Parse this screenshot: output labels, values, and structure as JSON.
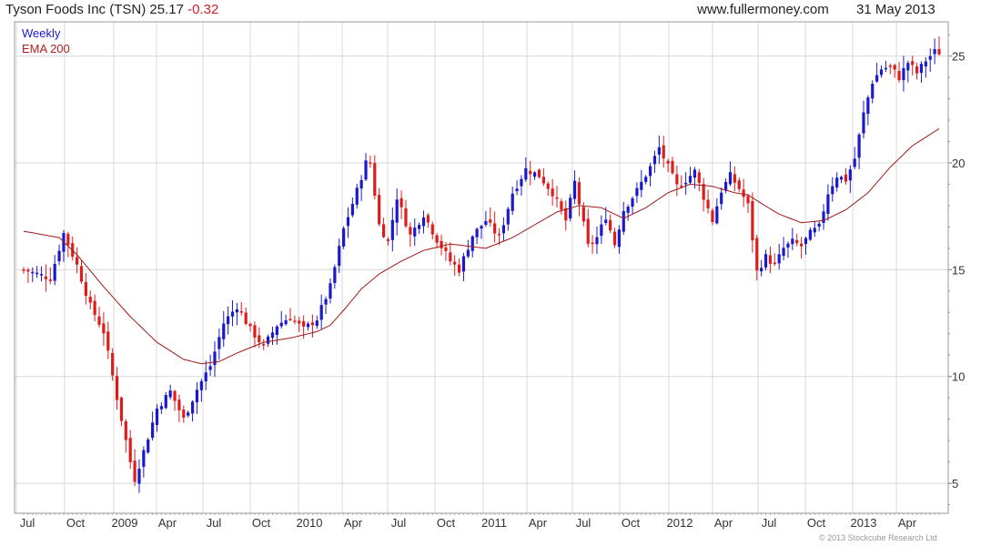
{
  "header": {
    "title": "Tyson Foods Inc (TSN) 25.17",
    "change": "-0.32",
    "site": "www.fullermoney.com",
    "date": "31 May 2013"
  },
  "legend": {
    "frequency": "Weekly",
    "ema": "EMA 200"
  },
  "copyright": "© 2013 Stockcube Research Ltd",
  "colors": {
    "up": "#1a1acc",
    "down": "#dd1c1c",
    "ema": "#a01818",
    "grid": "#d8d8d8",
    "frame": "#9a9a9a"
  },
  "chart_data": {
    "type": "candlestick",
    "frequency": "Weekly",
    "overlay": "EMA 200",
    "y_axis": {
      "side": "right",
      "ticks": [
        5,
        10,
        15,
        20,
        25
      ],
      "range": [
        3.6,
        26.6
      ]
    },
    "x_axis": {
      "ticks": [
        "Jul",
        "Oct",
        "2009",
        "Apr",
        "Jul",
        "Oct",
        "2010",
        "Apr",
        "Jul",
        "Oct",
        "2011",
        "Apr",
        "Jul",
        "Oct",
        "2012",
        "Apr",
        "Jul",
        "Oct",
        "2013",
        "Apr"
      ]
    },
    "grid": true,
    "close_path": [
      [
        0,
        15.0
      ],
      [
        6,
        14.6
      ],
      [
        9,
        16.7
      ],
      [
        12,
        15.2
      ],
      [
        15,
        13.3
      ],
      [
        18,
        12.1
      ],
      [
        21,
        9.0
      ],
      [
        24,
        6.0
      ],
      [
        25,
        5.2
      ],
      [
        27,
        6.5
      ],
      [
        30,
        8.5
      ],
      [
        33,
        9.3
      ],
      [
        36,
        8.0
      ],
      [
        39,
        9.4
      ],
      [
        42,
        10.5
      ],
      [
        45,
        12.5
      ],
      [
        48,
        13.3
      ],
      [
        51,
        12.2
      ],
      [
        54,
        11.4
      ],
      [
        57,
        12.4
      ],
      [
        60,
        12.8
      ],
      [
        63,
        12.2
      ],
      [
        66,
        12.7
      ],
      [
        69,
        14.2
      ],
      [
        72,
        16.9
      ],
      [
        75,
        18.7
      ],
      [
        77,
        20.0
      ],
      [
        78,
        20.0
      ],
      [
        80,
        17.1
      ],
      [
        82,
        16.3
      ],
      [
        84,
        18.4
      ],
      [
        87,
        16.6
      ],
      [
        90,
        17.6
      ],
      [
        93,
        16.4
      ],
      [
        96,
        15.4
      ],
      [
        98,
        15.0
      ],
      [
        101,
        16.6
      ],
      [
        104,
        17.3
      ],
      [
        107,
        16.5
      ],
      [
        110,
        18.6
      ],
      [
        113,
        19.7
      ],
      [
        116,
        19.4
      ],
      [
        119,
        18.6
      ],
      [
        122,
        17.3
      ],
      [
        124,
        19.1
      ],
      [
        127,
        16.1
      ],
      [
        129,
        16.5
      ],
      [
        131,
        17.5
      ],
      [
        133,
        16.2
      ],
      [
        135,
        17.8
      ],
      [
        138,
        18.7
      ],
      [
        141,
        19.8
      ],
      [
        143,
        20.7
      ],
      [
        145,
        19.8
      ],
      [
        147,
        18.9
      ],
      [
        149,
        19.2
      ],
      [
        151,
        19.6
      ],
      [
        153,
        18.4
      ],
      [
        155,
        17.3
      ],
      [
        157,
        18.7
      ],
      [
        159,
        19.4
      ],
      [
        161,
        18.8
      ],
      [
        163,
        18.0
      ],
      [
        165,
        14.9
      ],
      [
        167,
        15.6
      ],
      [
        169,
        15.2
      ],
      [
        171,
        16.0
      ],
      [
        173,
        16.3
      ],
      [
        175,
        16.1
      ],
      [
        177,
        16.7
      ],
      [
        179,
        17.0
      ],
      [
        181,
        18.6
      ],
      [
        183,
        19.4
      ],
      [
        185,
        19.2
      ],
      [
        187,
        20.2
      ],
      [
        189,
        22.3
      ],
      [
        191,
        23.8
      ],
      [
        193,
        24.4
      ],
      [
        195,
        24.5
      ],
      [
        197,
        24.0
      ],
      [
        199,
        24.7
      ],
      [
        201,
        24.2
      ],
      [
        203,
        24.8
      ],
      [
        205,
        25.2
      ],
      [
        206,
        25.17
      ]
    ],
    "ema_path": [
      [
        0,
        16.8
      ],
      [
        8,
        16.5
      ],
      [
        12,
        15.7
      ],
      [
        18,
        14.2
      ],
      [
        24,
        12.8
      ],
      [
        30,
        11.6
      ],
      [
        36,
        10.8
      ],
      [
        40,
        10.6
      ],
      [
        44,
        10.7
      ],
      [
        48,
        11.1
      ],
      [
        54,
        11.6
      ],
      [
        60,
        11.8
      ],
      [
        66,
        12.1
      ],
      [
        69,
        12.4
      ],
      [
        72,
        13.1
      ],
      [
        76,
        14.1
      ],
      [
        80,
        14.8
      ],
      [
        85,
        15.4
      ],
      [
        90,
        15.9
      ],
      [
        96,
        16.2
      ],
      [
        100,
        16.1
      ],
      [
        104,
        16.0
      ],
      [
        110,
        16.5
      ],
      [
        115,
        17.1
      ],
      [
        120,
        17.7
      ],
      [
        125,
        18.0
      ],
      [
        130,
        17.9
      ],
      [
        135,
        17.4
      ],
      [
        140,
        17.9
      ],
      [
        145,
        18.6
      ],
      [
        150,
        19.0
      ],
      [
        155,
        18.9
      ],
      [
        160,
        18.6
      ],
      [
        163,
        18.5
      ],
      [
        166,
        18.1
      ],
      [
        170,
        17.6
      ],
      [
        175,
        17.2
      ],
      [
        180,
        17.3
      ],
      [
        185,
        17.8
      ],
      [
        190,
        18.6
      ],
      [
        195,
        19.8
      ],
      [
        200,
        20.8
      ],
      [
        206,
        21.6
      ]
    ],
    "note": "close_path and ema_path are [week index, price] points approximated from the chart; 207 weekly bars from Jun 2008 to 31 May 2013"
  }
}
